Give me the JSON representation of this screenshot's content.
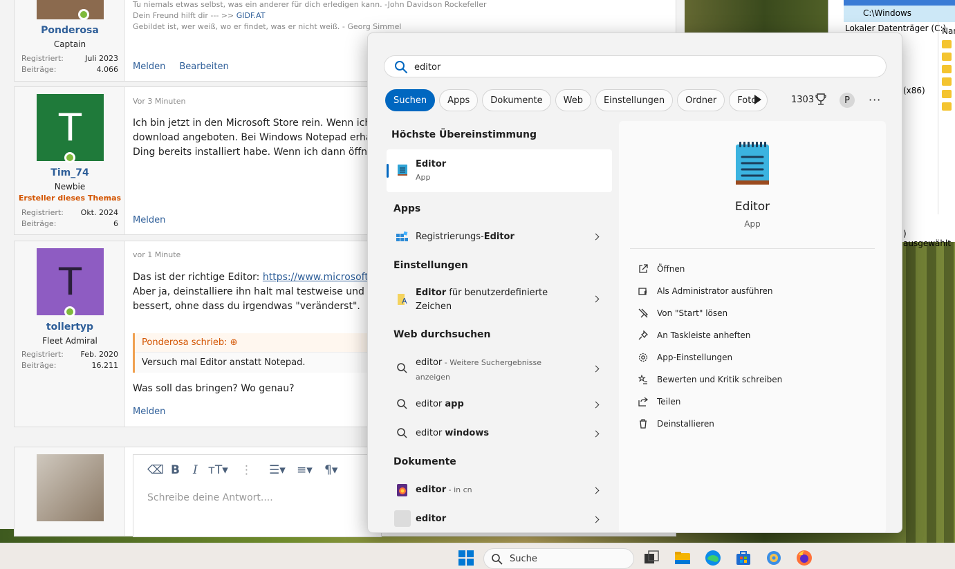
{
  "forum": {
    "posts": [
      {
        "username": "Ponderosa",
        "rank": "Captain",
        "registered_label": "Registriert:",
        "registered": "Juli 2023",
        "posts_label": "Beiträge:",
        "posts": "4.066",
        "sig_lines": [
          "Tu niemals etwas selbst, was ein anderer für dich erledigen kann. -John Davidson Rockefeller",
          "Dein Freund hilft dir --- >> ",
          "Gebildet ist, wer weiß, wo er findet, was er nicht weiß. - Georg Simmel"
        ],
        "sig_link": "GIDF.AT",
        "actions": [
          "Melden",
          "Bearbeiten"
        ]
      },
      {
        "username": "Tim_74",
        "avatar_letter": "T",
        "avatar_color": "#1f7a3a",
        "rank": "Newbie",
        "badge": "Ersteller dieses Themas",
        "registered_label": "Registriert:",
        "registered": "Okt. 2024",
        "posts_label": "Beiträge:",
        "posts": "6",
        "time": "Vor 3 Minuten",
        "text_lines": [
          "Ich bin jetzt in den Microsoft Store rein. Wenn ich da",
          "download angeboten. Bei Windows Notepad erhalt",
          "Ding bereits installiert habe. Wenn ich dann öffne, e"
        ],
        "actions": [
          "Melden"
        ]
      },
      {
        "username": "tollertyp",
        "avatar_letter": "T",
        "avatar_color": "#8e5cc2",
        "rank": "Fleet Admiral",
        "registered_label": "Registriert:",
        "registered": "Feb. 2020",
        "posts_label": "Beiträge:",
        "posts": "16.211",
        "time": "vor 1 Minute",
        "text_line1_prefix": "Das ist der richtige Editor: ",
        "text_link": "https://www.microsoft.co",
        "text_lines": [
          "Aber ja, deinstalliere ihn halt mal testweise und inst",
          "bessert, ohne dass du irgendwas \"veränderst\"."
        ],
        "quote_author": "Ponderosa schrieb:",
        "quote_text": "Versuch mal Editor anstatt Notepad.",
        "reply_text": "Was soll das bringen? Wo genau?",
        "actions": [
          "Melden"
        ]
      }
    ],
    "reply_placeholder": "Schreibe deine Antwort...."
  },
  "explorer": {
    "title": "C:\\Windows",
    "drive": "Lokaler Datenträger (C:)",
    "column": "Nar",
    "x86": "(x86)",
    "status": ") ausgewählt"
  },
  "start": {
    "search_value": "editor",
    "filters": [
      "Suchen",
      "Apps",
      "Dokumente",
      "Web",
      "Einstellungen",
      "Ordner",
      "Foto"
    ],
    "points": "1303",
    "profile_letter": "P",
    "more": "···",
    "best_header": "Höchste Übereinstimmung",
    "best": {
      "name": "Editor",
      "type": "App"
    },
    "apps_header": "Apps",
    "apps": [
      {
        "prefix": "Registrierungs-",
        "bold": "Editor"
      }
    ],
    "settings_header": "Einstellungen",
    "settings": [
      {
        "bold": "Editor",
        "rest": " für benutzerdefinierte",
        "line2": "Zeichen"
      }
    ],
    "web_header": "Web durchsuchen",
    "web": [
      {
        "bold": "editor",
        "rest": " - Weitere Suchergebnisse",
        "line2": "anzeigen"
      },
      {
        "plain": "editor ",
        "bold": "app"
      },
      {
        "plain": "editor ",
        "bold": "windows"
      }
    ],
    "docs_header": "Dokumente",
    "docs": [
      {
        "bold": "editor",
        "rest": " - in cn"
      },
      {
        "bold": "editor"
      }
    ],
    "detail": {
      "name": "Editor",
      "type": "App",
      "actions": [
        {
          "icon": "open-icon",
          "label": "Öffnen"
        },
        {
          "icon": "admin-shield-icon",
          "label": "Als Administrator ausführen"
        },
        {
          "icon": "unpin-icon",
          "label": "Von \"Start\" lösen"
        },
        {
          "icon": "pin-icon",
          "label": "An Taskleiste anheften"
        },
        {
          "icon": "gear-icon",
          "label": "App-Einstellungen"
        },
        {
          "icon": "rate-icon",
          "label": "Bewerten und Kritik schreiben"
        },
        {
          "icon": "share-icon",
          "label": "Teilen"
        },
        {
          "icon": "trash-icon",
          "label": "Deinstallieren"
        }
      ]
    }
  },
  "taskbar": {
    "search_label": "Suche"
  },
  "colors": {
    "accent": "#0067c0",
    "link": "#2f5f99",
    "badge": "#d35400"
  }
}
